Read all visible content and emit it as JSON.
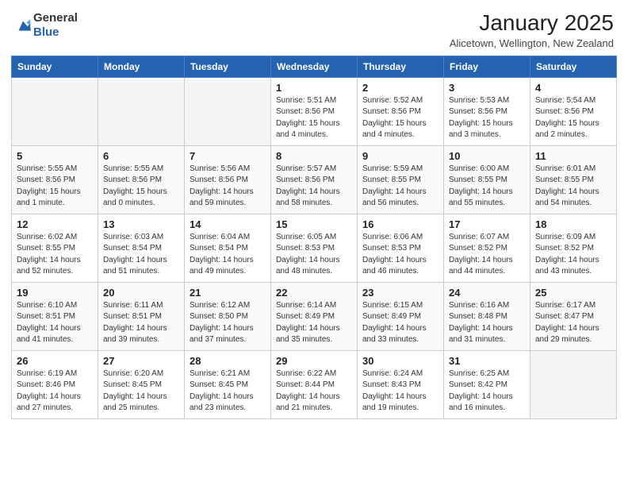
{
  "header": {
    "logo_general": "General",
    "logo_blue": "Blue",
    "title": "January 2025",
    "subtitle": "Alicetown, Wellington, New Zealand"
  },
  "days_of_week": [
    "Sunday",
    "Monday",
    "Tuesday",
    "Wednesday",
    "Thursday",
    "Friday",
    "Saturday"
  ],
  "weeks": [
    [
      {
        "day": "",
        "detail": ""
      },
      {
        "day": "",
        "detail": ""
      },
      {
        "day": "",
        "detail": ""
      },
      {
        "day": "1",
        "detail": "Sunrise: 5:51 AM\nSunset: 8:56 PM\nDaylight: 15 hours\nand 4 minutes."
      },
      {
        "day": "2",
        "detail": "Sunrise: 5:52 AM\nSunset: 8:56 PM\nDaylight: 15 hours\nand 4 minutes."
      },
      {
        "day": "3",
        "detail": "Sunrise: 5:53 AM\nSunset: 8:56 PM\nDaylight: 15 hours\nand 3 minutes."
      },
      {
        "day": "4",
        "detail": "Sunrise: 5:54 AM\nSunset: 8:56 PM\nDaylight: 15 hours\nand 2 minutes."
      }
    ],
    [
      {
        "day": "5",
        "detail": "Sunrise: 5:55 AM\nSunset: 8:56 PM\nDaylight: 15 hours\nand 1 minute."
      },
      {
        "day": "6",
        "detail": "Sunrise: 5:55 AM\nSunset: 8:56 PM\nDaylight: 15 hours\nand 0 minutes."
      },
      {
        "day": "7",
        "detail": "Sunrise: 5:56 AM\nSunset: 8:56 PM\nDaylight: 14 hours\nand 59 minutes."
      },
      {
        "day": "8",
        "detail": "Sunrise: 5:57 AM\nSunset: 8:56 PM\nDaylight: 14 hours\nand 58 minutes."
      },
      {
        "day": "9",
        "detail": "Sunrise: 5:59 AM\nSunset: 8:55 PM\nDaylight: 14 hours\nand 56 minutes."
      },
      {
        "day": "10",
        "detail": "Sunrise: 6:00 AM\nSunset: 8:55 PM\nDaylight: 14 hours\nand 55 minutes."
      },
      {
        "day": "11",
        "detail": "Sunrise: 6:01 AM\nSunset: 8:55 PM\nDaylight: 14 hours\nand 54 minutes."
      }
    ],
    [
      {
        "day": "12",
        "detail": "Sunrise: 6:02 AM\nSunset: 8:55 PM\nDaylight: 14 hours\nand 52 minutes."
      },
      {
        "day": "13",
        "detail": "Sunrise: 6:03 AM\nSunset: 8:54 PM\nDaylight: 14 hours\nand 51 minutes."
      },
      {
        "day": "14",
        "detail": "Sunrise: 6:04 AM\nSunset: 8:54 PM\nDaylight: 14 hours\nand 49 minutes."
      },
      {
        "day": "15",
        "detail": "Sunrise: 6:05 AM\nSunset: 8:53 PM\nDaylight: 14 hours\nand 48 minutes."
      },
      {
        "day": "16",
        "detail": "Sunrise: 6:06 AM\nSunset: 8:53 PM\nDaylight: 14 hours\nand 46 minutes."
      },
      {
        "day": "17",
        "detail": "Sunrise: 6:07 AM\nSunset: 8:52 PM\nDaylight: 14 hours\nand 44 minutes."
      },
      {
        "day": "18",
        "detail": "Sunrise: 6:09 AM\nSunset: 8:52 PM\nDaylight: 14 hours\nand 43 minutes."
      }
    ],
    [
      {
        "day": "19",
        "detail": "Sunrise: 6:10 AM\nSunset: 8:51 PM\nDaylight: 14 hours\nand 41 minutes."
      },
      {
        "day": "20",
        "detail": "Sunrise: 6:11 AM\nSunset: 8:51 PM\nDaylight: 14 hours\nand 39 minutes."
      },
      {
        "day": "21",
        "detail": "Sunrise: 6:12 AM\nSunset: 8:50 PM\nDaylight: 14 hours\nand 37 minutes."
      },
      {
        "day": "22",
        "detail": "Sunrise: 6:14 AM\nSunset: 8:49 PM\nDaylight: 14 hours\nand 35 minutes."
      },
      {
        "day": "23",
        "detail": "Sunrise: 6:15 AM\nSunset: 8:49 PM\nDaylight: 14 hours\nand 33 minutes."
      },
      {
        "day": "24",
        "detail": "Sunrise: 6:16 AM\nSunset: 8:48 PM\nDaylight: 14 hours\nand 31 minutes."
      },
      {
        "day": "25",
        "detail": "Sunrise: 6:17 AM\nSunset: 8:47 PM\nDaylight: 14 hours\nand 29 minutes."
      }
    ],
    [
      {
        "day": "26",
        "detail": "Sunrise: 6:19 AM\nSunset: 8:46 PM\nDaylight: 14 hours\nand 27 minutes."
      },
      {
        "day": "27",
        "detail": "Sunrise: 6:20 AM\nSunset: 8:45 PM\nDaylight: 14 hours\nand 25 minutes."
      },
      {
        "day": "28",
        "detail": "Sunrise: 6:21 AM\nSunset: 8:45 PM\nDaylight: 14 hours\nand 23 minutes."
      },
      {
        "day": "29",
        "detail": "Sunrise: 6:22 AM\nSunset: 8:44 PM\nDaylight: 14 hours\nand 21 minutes."
      },
      {
        "day": "30",
        "detail": "Sunrise: 6:24 AM\nSunset: 8:43 PM\nDaylight: 14 hours\nand 19 minutes."
      },
      {
        "day": "31",
        "detail": "Sunrise: 6:25 AM\nSunset: 8:42 PM\nDaylight: 14 hours\nand 16 minutes."
      },
      {
        "day": "",
        "detail": ""
      }
    ]
  ]
}
